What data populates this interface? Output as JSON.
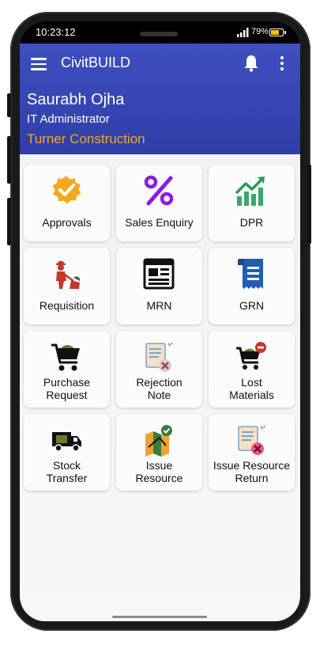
{
  "status": {
    "time": "10:23:12",
    "battery": "79%",
    "battery_level": 0.79
  },
  "appbar": {
    "title": "CivitBUILD",
    "user_name": "Saurabh Ojha",
    "user_role": "IT Administrator",
    "company": "Turner Construction"
  },
  "colors": {
    "primary": "#3442af",
    "accent": "#f5a623",
    "tile_bg": "#fbfbfb"
  },
  "tiles": [
    {
      "label": "Approvals",
      "icon": "approval-badge-icon"
    },
    {
      "label": "Sales Enquiry",
      "icon": "percent-icon"
    },
    {
      "label": "DPR",
      "icon": "growth-chart-icon"
    },
    {
      "label": "Requisition",
      "icon": "construction-worker-icon"
    },
    {
      "label": "MRN",
      "icon": "newspaper-icon"
    },
    {
      "label": "GRN",
      "icon": "receipt-icon"
    },
    {
      "label": "Purchase\nRequest",
      "icon": "cart-icon"
    },
    {
      "label": "Rejection\nNote",
      "icon": "rejected-document-icon"
    },
    {
      "label": "Lost\nMaterials",
      "icon": "cart-remove-icon"
    },
    {
      "label": "Stock\nTransfer",
      "icon": "truck-icon"
    },
    {
      "label": "Issue\nResource",
      "icon": "map-check-icon"
    },
    {
      "label": "Issue Resource\nReturn",
      "icon": "document-return-icon"
    }
  ]
}
